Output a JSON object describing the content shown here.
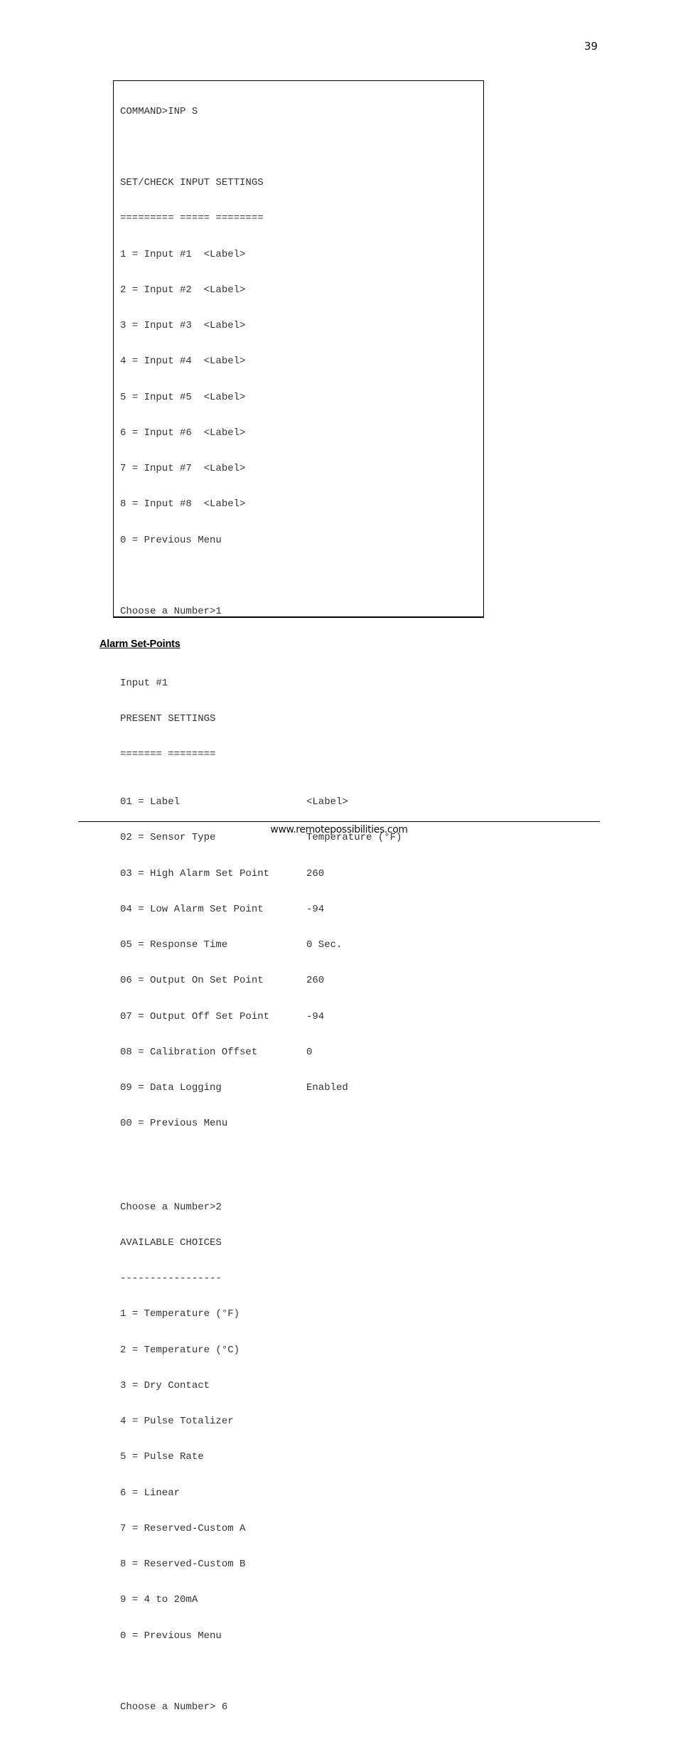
{
  "page": {
    "number": "39",
    "footer_url": "www.remotepossibilities.com",
    "section_heading": "Alarm Set-Points"
  },
  "terminal": {
    "command_line": "COMMAND>INP S",
    "menu1": {
      "title": "SET/CHECK INPUT SETTINGS",
      "underline": "========= ===== ========",
      "items": [
        "1 = Input #1  <Label>",
        "2 = Input #2  <Label>",
        "3 = Input #3  <Label>",
        "4 = Input #4  <Label>",
        "5 = Input #5  <Label>",
        "6 = Input #6  <Label>",
        "7 = Input #7  <Label>",
        "8 = Input #8  <Label>",
        "0 = Previous Menu"
      ],
      "prompt": "Choose a Number>1"
    },
    "menu2": {
      "input_name": "Input #1",
      "title": "PRESENT SETTINGS",
      "underline": "======= ========",
      "settings": [
        {
          "key": "01 = Label",
          "value": "<Label>"
        },
        {
          "key": "02 = Sensor Type",
          "value": "Temperature (°F)"
        },
        {
          "key": "03 = High Alarm Set Point",
          "value": "260"
        },
        {
          "key": "04 = Low Alarm Set Point",
          "value": "-94"
        },
        {
          "key": "05 = Response Time",
          "value": "0 Sec."
        },
        {
          "key": "06 = Output On Set Point",
          "value": "260"
        },
        {
          "key": "07 = Output Off Set Point",
          "value": "-94"
        },
        {
          "key": "08 = Calibration Offset",
          "value": "0"
        },
        {
          "key": "09 = Data Logging",
          "value": "Enabled"
        },
        {
          "key": "00 = Previous Menu",
          "value": ""
        }
      ],
      "prompt": "Choose a Number>2"
    },
    "menu3": {
      "title": "AVAILABLE CHOICES",
      "underline": "-----------------",
      "items": [
        "1 = Temperature (°F)",
        "2 = Temperature (°C)",
        "3 = Dry Contact",
        "4 = Pulse Totalizer",
        "5 = Pulse Rate",
        "6 = Linear",
        "7 = Reserved-Custom A",
        "8 = Reserved-Custom B",
        "9 = 4 to 20mA",
        "0 = Previous Menu"
      ],
      "prompt": "Choose a Number> 6"
    }
  }
}
